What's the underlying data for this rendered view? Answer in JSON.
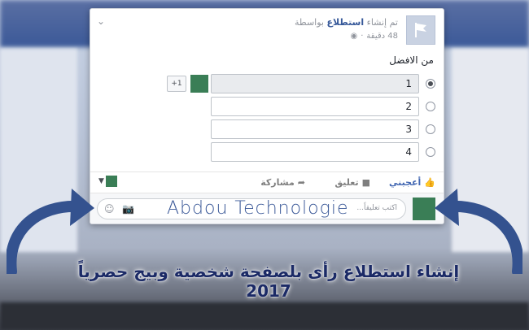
{
  "post": {
    "header_prefix": "تم إنشاء",
    "header_bold": "استطلاع",
    "header_suffix": "بواسطة",
    "time": "48 دقيقة",
    "text": "من الافضل"
  },
  "poll": {
    "options": [
      {
        "label": "1",
        "selected": true
      },
      {
        "label": "2",
        "selected": false
      },
      {
        "label": "3",
        "selected": false
      },
      {
        "label": "4",
        "selected": false
      }
    ],
    "more_voters": "+1"
  },
  "actions": {
    "like": "أعجبني",
    "comment": "تعليق",
    "share": "مشاركة"
  },
  "comment_bar": {
    "placeholder": "اكتب تعليقاً..."
  },
  "overlay": {
    "watermark": "Abdou Technologie",
    "caption": "إنشاء استطلاع رأى بلصفحة شخصية  وبيج  حصرياً 2017"
  },
  "colors": {
    "facebook_blue": "#3b5998",
    "link": "#365899",
    "like_blue": "#4267b2",
    "arrow": "#34528f"
  },
  "icons": [
    "flag-icon",
    "globe-icon",
    "chevron-down-icon",
    "radio-icon",
    "like-icon",
    "comment-icon",
    "share-icon",
    "camera-icon",
    "emoji-icon",
    "curved-arrow-icon"
  ]
}
